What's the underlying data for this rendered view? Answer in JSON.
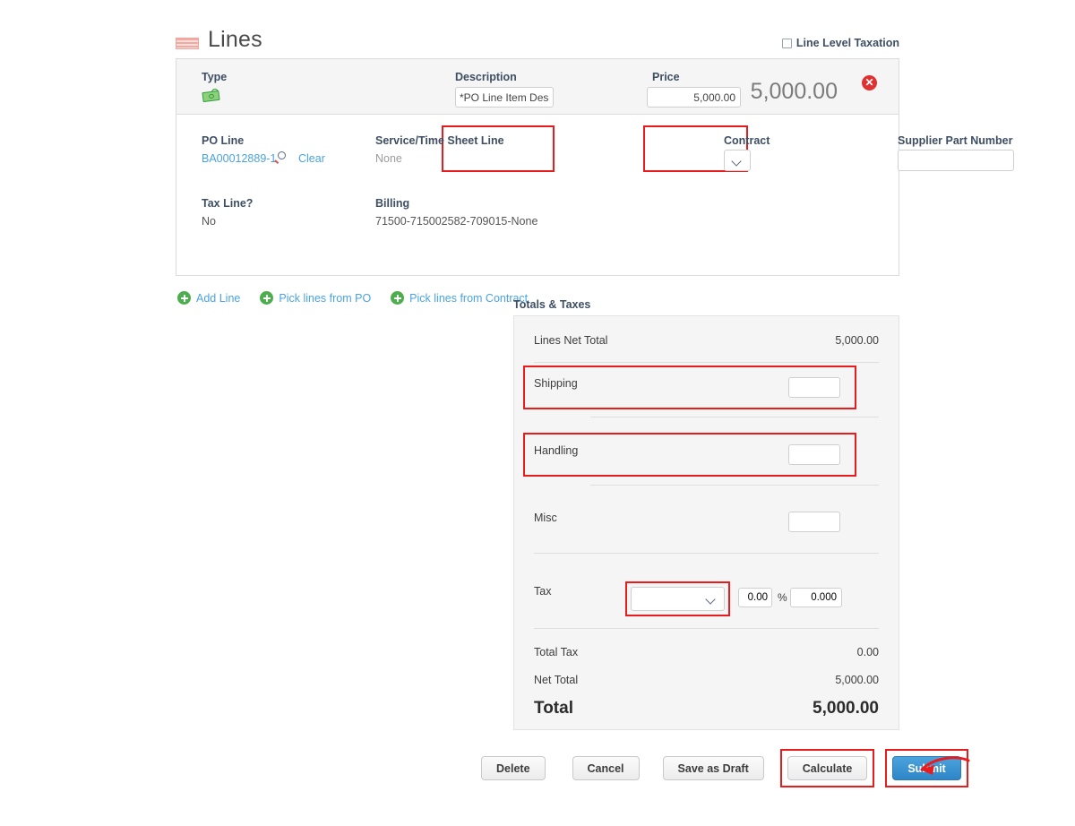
{
  "header": {
    "title": "Lines",
    "icon": "lines-icon",
    "line_level_taxation_label": "Line Level Taxation",
    "line_level_taxation_checked": false
  },
  "line": {
    "type_label": "Type",
    "type_icon": "money-icon",
    "description_label": "Description",
    "description_value": "*PO Line Item Desc",
    "price_label": "Price",
    "price_value": "5,000.00",
    "amount": "5,000.00",
    "delete_icon": "delete-circle-icon",
    "po_line_label": "PO Line",
    "po_line_value": "BA00012889-1",
    "po_line_search_icon": "search-icon",
    "po_line_clear_label": "Clear",
    "service_time_sheet_label": "Service/Time Sheet Line",
    "service_time_sheet_value": "None",
    "contract_label": "Contract",
    "contract_value": "",
    "supplier_part_number_label": "Supplier Part Number",
    "supplier_part_number_value": "",
    "tax_line_label": "Tax Line?",
    "tax_line_value": "No",
    "billing_label": "Billing",
    "billing_value": "71500-715002582-709015-None"
  },
  "line_actions": [
    {
      "label": "Add Line",
      "icon": "plus-circle-icon"
    },
    {
      "label": "Pick lines from PO",
      "icon": "plus-circle-icon"
    },
    {
      "label": "Pick lines from Contract",
      "icon": "plus-circle-icon"
    }
  ],
  "totals": {
    "title": "Totals & Taxes",
    "lines_net_total_label": "Lines Net Total",
    "lines_net_total_value": "5,000.00",
    "shipping_label": "Shipping",
    "shipping_value": "",
    "handling_label": "Handling",
    "handling_value": "",
    "misc_label": "Misc",
    "misc_value": "",
    "tax_label": "Tax",
    "tax_code_value": "",
    "tax_rate_value": "0.00",
    "tax_percent_sign": "%",
    "tax_amount_value": "0.000",
    "total_tax_label": "Total Tax",
    "total_tax_value": "0.00",
    "net_total_label": "Net Total",
    "net_total_value": "5,000.00",
    "total_label": "Total",
    "total_value": "5,000.00"
  },
  "footer": {
    "delete_label": "Delete",
    "cancel_label": "Cancel",
    "save_draft_label": "Save as Draft",
    "calculate_label": "Calculate",
    "submit_label": "Submit"
  },
  "colors": {
    "accent_link": "#4aa3e0",
    "submit_blue": "#2e86c8",
    "highlight_red": "#e81c1c",
    "plus_green": "#4cae4c",
    "label_blue": "#3e4e63"
  }
}
